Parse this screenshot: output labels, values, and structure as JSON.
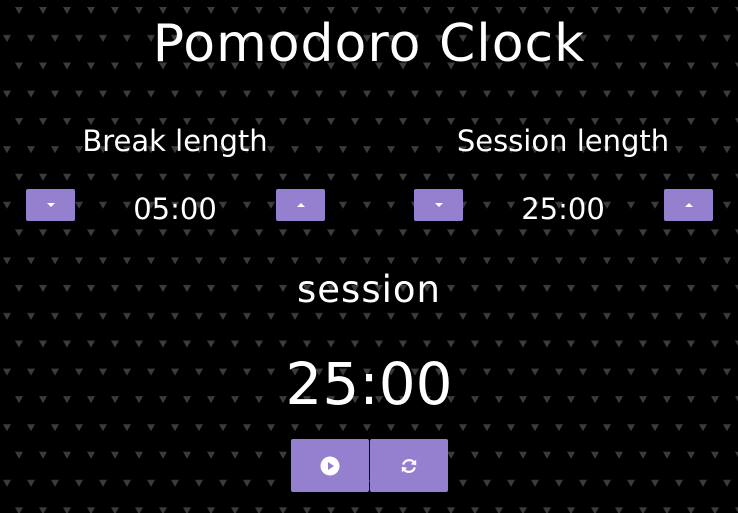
{
  "title": "Pomodoro Clock",
  "break": {
    "label": "Break length",
    "value": "05:00"
  },
  "session": {
    "label": "Session length",
    "value": "25:00"
  },
  "timer": {
    "label": "session",
    "value": "25:00"
  },
  "icons": {
    "decrement": "caret-down-icon",
    "increment": "caret-up-icon",
    "play": "play-circle-icon",
    "reset": "refresh-icon"
  },
  "colors": {
    "background": "#000000",
    "pattern": "#3c3c3c",
    "button": "#9580d0",
    "text": "#ffffff"
  }
}
